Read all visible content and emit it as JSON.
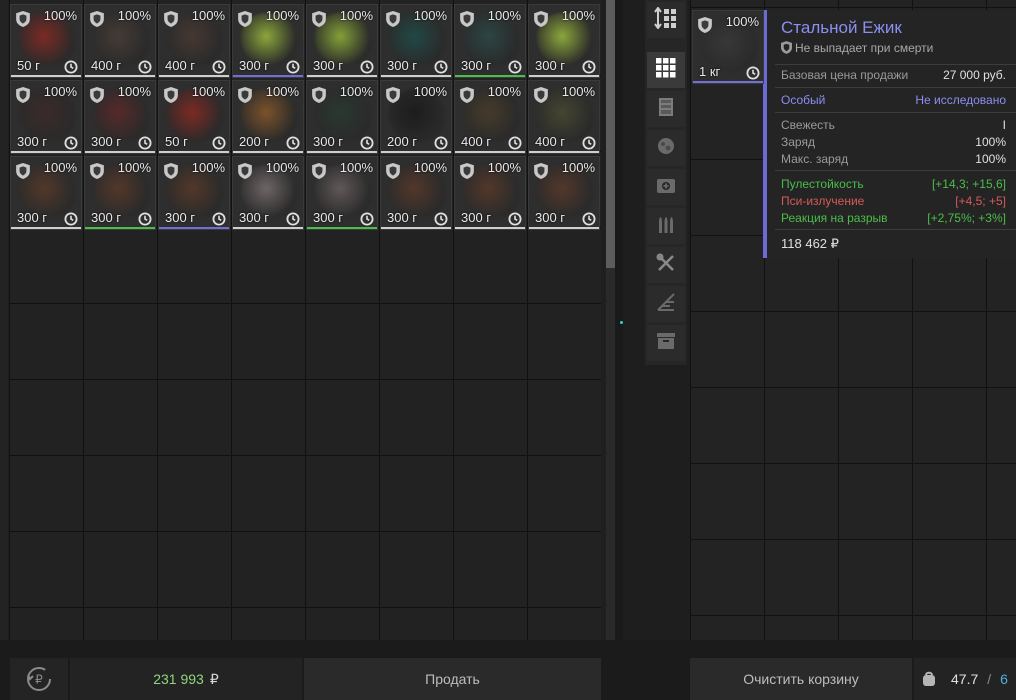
{
  "left_items": [
    {
      "pct": "100%",
      "weight": "50 г",
      "art": "#8a2a22",
      "line": "#cfcfcf"
    },
    {
      "pct": "100%",
      "weight": "400 г",
      "art": "#4a3e36",
      "line": "#cfcfcf"
    },
    {
      "pct": "100%",
      "weight": "400 г",
      "art": "#4a3a33",
      "line": "#cfcfcf"
    },
    {
      "pct": "100%",
      "weight": "300 г",
      "art": "#9ebd3e",
      "line": "#6f6fd6"
    },
    {
      "pct": "100%",
      "weight": "300 г",
      "art": "#94b63a",
      "line": "#cfcfcf"
    },
    {
      "pct": "100%",
      "weight": "300 г",
      "art": "#1f4e4a",
      "line": "#cfcfcf"
    },
    {
      "pct": "100%",
      "weight": "300 г",
      "art": "#2c4a48",
      "line": "#4bbd4b"
    },
    {
      "pct": "100%",
      "weight": "300 г",
      "art": "#9ebd3e",
      "line": "#cfcfcf"
    },
    {
      "pct": "100%",
      "weight": "300 г",
      "art": "#3e2a2a",
      "line": "#cfcfcf"
    },
    {
      "pct": "100%",
      "weight": "300 г",
      "art": "#5e2a2a",
      "line": "#cfcfcf"
    },
    {
      "pct": "100%",
      "weight": "50 г",
      "art": "#8a2a22",
      "line": "#cfcfcf"
    },
    {
      "pct": "100%",
      "weight": "200 г",
      "art": "#8a5a2a",
      "line": "#cfcfcf"
    },
    {
      "pct": "100%",
      "weight": "300 г",
      "art": "#2a3a30",
      "line": "#cfcfcf"
    },
    {
      "pct": "100%",
      "weight": "200 г",
      "art": "#1a1a1a",
      "line": "#cfcfcf"
    },
    {
      "pct": "100%",
      "weight": "400 г",
      "art": "#4a3e2a",
      "line": "#cfcfcf"
    },
    {
      "pct": "100%",
      "weight": "400 г",
      "art": "#4a4a32",
      "line": "#cfcfcf"
    },
    {
      "pct": "100%",
      "weight": "300 г",
      "art": "#5a3a2a",
      "line": "#cfcfcf"
    },
    {
      "pct": "100%",
      "weight": "300 г",
      "art": "#5a3a2a",
      "line": "#4bbd4b"
    },
    {
      "pct": "100%",
      "weight": "300 г",
      "art": "#5a3a2a",
      "line": "#6f6fd6"
    },
    {
      "pct": "100%",
      "weight": "300 г",
      "art": "#7a7070",
      "line": "#cfcfcf"
    },
    {
      "pct": "100%",
      "weight": "300 г",
      "art": "#6a6060",
      "line": "#4bbd4b"
    },
    {
      "pct": "100%",
      "weight": "300 г",
      "art": "#5a3a2a",
      "line": "#cfcfcf"
    },
    {
      "pct": "100%",
      "weight": "300 г",
      "art": "#5a3a2a",
      "line": "#cfcfcf"
    },
    {
      "pct": "100%",
      "weight": "300 г",
      "art": "#5a3a2a",
      "line": "#cfcfcf"
    }
  ],
  "cart_item": {
    "pct": "100%",
    "weight": "1 кг",
    "art": "#3a3a3a",
    "line": "#6f6fd6"
  },
  "category_icons": [
    "sort-icon",
    "grid-icon",
    "armor-icon",
    "artifact-icon",
    "medkit-icon",
    "ammo-icon",
    "tools-icon",
    "attachments-icon",
    "container-icon"
  ],
  "tooltip": {
    "title": "Стальной Ежик",
    "subtitle": "Не выпадает при смерти",
    "base_price_label": "Базовая цена продажи",
    "base_price_value": "27 000 руб.",
    "rarity_label": "Особый",
    "rarity_value": "Не исследовано",
    "freshness_label": "Свежесть",
    "freshness_value": "I",
    "charge_label": "Заряд",
    "charge_value": "100%",
    "max_charge_label": "Макс. заряд",
    "max_charge_value": "100%",
    "stat1_label": "Пулестойкость",
    "stat1_value": "[+14,3; +15,6]",
    "stat2_label": "Пси-излучение",
    "stat2_value": "[+4,5; +5]",
    "stat3_label": "Реакция на разрыв",
    "stat3_value": "[+2,75%; +3%]",
    "total_price": "118 462 ₽"
  },
  "bottom": {
    "balance": "231 993",
    "currency": "₽",
    "sell_label": "Продать",
    "clear_cart_label": "Очистить корзину",
    "weight_current": "47.7",
    "weight_sep": "/",
    "weight_max": "6"
  },
  "colors": {
    "accent_purple": "#8a8ff0",
    "stat_green": "#4bbd4b",
    "stat_red": "#d65a5a",
    "balance_green": "#8fd67a",
    "weight_blue": "#4fb0e0"
  }
}
